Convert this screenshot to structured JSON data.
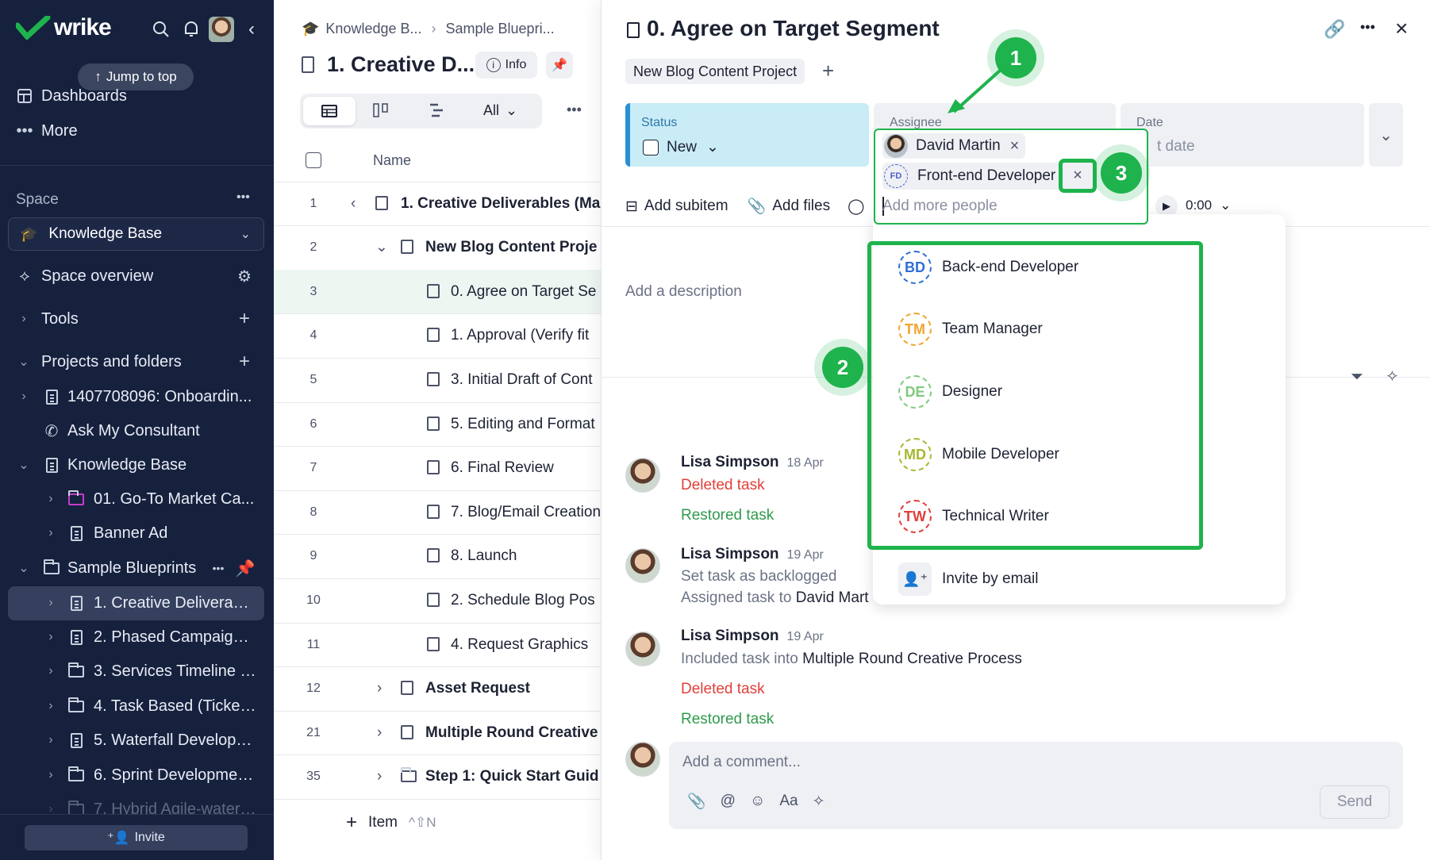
{
  "sidebar": {
    "brand": "wrike",
    "jump_to_top": "Jump to top",
    "dashboards": "Dashboards",
    "more": "More",
    "space_heading": "Space",
    "space_selected": "Knowledge Base",
    "space_overview": "Space overview",
    "tools": "Tools",
    "projects_and_folders": "Projects and folders",
    "tree": [
      {
        "label": "1407708096: Onboardin..."
      },
      {
        "label": "Ask My Consultant"
      },
      {
        "label": "Knowledge Base"
      },
      {
        "label": "01. Go-To Market Ca..."
      },
      {
        "label": "Banner Ad"
      },
      {
        "label": "Sample Blueprints"
      },
      {
        "label": "1. Creative Deliverabl..."
      },
      {
        "label": "2. Phased Campaign ..."
      },
      {
        "label": "3. Services Timeline (..."
      },
      {
        "label": "4. Task Based (Ticket..."
      },
      {
        "label": "5. Waterfall Developm..."
      },
      {
        "label": "6. Sprint Developmen..."
      },
      {
        "label": "7. Hybrid Agile-waterf..."
      }
    ],
    "invite": "Invite"
  },
  "main": {
    "breadcrumb": [
      "Knowledge B...",
      "Sample Bluepri..."
    ],
    "title": "1. Creative D...",
    "info": "Info",
    "view_filter": "All",
    "column_name": "Name",
    "rows": [
      {
        "num": "1",
        "name": "1. Creative Deliverables (Ma"
      },
      {
        "num": "2",
        "name": "New Blog Content Proje"
      },
      {
        "num": "3",
        "name": "0. Agree on Target Se"
      },
      {
        "num": "4",
        "name": "1. Approval (Verify fit"
      },
      {
        "num": "5",
        "name": "3. Initial Draft of Cont"
      },
      {
        "num": "6",
        "name": "5. Editing and Format"
      },
      {
        "num": "7",
        "name": "6. Final Review"
      },
      {
        "num": "8",
        "name": "7. Blog/Email Creation"
      },
      {
        "num": "9",
        "name": "8. Launch"
      },
      {
        "num": "10",
        "name": "2. Schedule Blog Pos"
      },
      {
        "num": "11",
        "name": "4. Request Graphics"
      },
      {
        "num": "12",
        "name": "Asset Request"
      },
      {
        "num": "21",
        "name": "Multiple Round Creative"
      },
      {
        "num": "35",
        "name": "Step 1: Quick Start Guid"
      }
    ],
    "add_item": "Item",
    "add_item_shortcut": "^⇧N"
  },
  "panel": {
    "task_title": "0. Agree on Target Segment",
    "project_tag": "New Blog Content Project",
    "status_label": "Status",
    "status_value": "New",
    "assignee_label": "Assignee",
    "date_label": "Date",
    "date_placeholder": "t date",
    "assignees": [
      "David Martin",
      "Front-end Developer"
    ],
    "fd_initials": "FD",
    "add_more_placeholder": "Add more people",
    "add_subitem": "Add subitem",
    "add_files": "Add files",
    "timer": "0:00",
    "description_placeholder": "Add a description",
    "suggestions": [
      {
        "initials": "BD",
        "name": "Back-end Developer",
        "color": "#2f6fd6"
      },
      {
        "initials": "TM",
        "name": "Team Manager",
        "color": "#f0a531"
      },
      {
        "initials": "DE",
        "name": "Designer",
        "color": "#7fc97f"
      },
      {
        "initials": "MD",
        "name": "Mobile Developer",
        "color": "#a9b832"
      },
      {
        "initials": "TW",
        "name": "Technical Writer",
        "color": "#e0403a"
      }
    ],
    "invite_by_email": "Invite by email",
    "activity": [
      {
        "user": "Lisa Simpson",
        "date": "18 Apr",
        "lines": [
          "Deleted task",
          "Restored task"
        ]
      },
      {
        "user": "Lisa Simpson",
        "date": "19 Apr",
        "lines": [
          "Set task as backlogged",
          "Assigned task to ",
          "David Mart"
        ]
      },
      {
        "user": "Lisa Simpson",
        "date": "19 Apr",
        "lines": [
          "Included task into ",
          "Multiple Round Creative Process",
          "Deleted task",
          "Restored task"
        ]
      }
    ],
    "comment_placeholder": "Add a comment...",
    "send": "Send",
    "font_btn": "Aa"
  },
  "callouts": [
    "1",
    "2",
    "3"
  ],
  "colors": {
    "sidebar_bg": "#16213e",
    "accent_green": "#1eb34c",
    "status_bg": "#c9ecf7",
    "deleted_red": "#e0403a",
    "restored_green": "#2f9a4c"
  }
}
